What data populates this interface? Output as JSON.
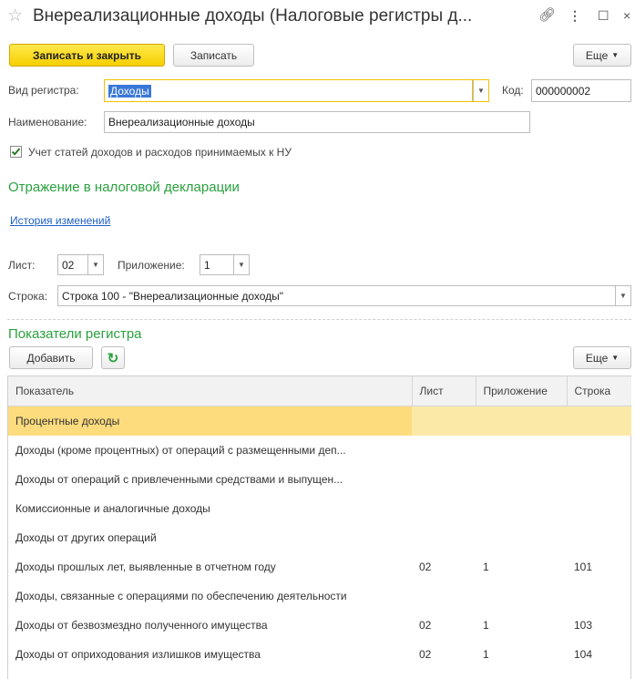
{
  "window": {
    "title": "Внереализационные доходы (Налоговые регистры д...",
    "controls": [
      "link-icon",
      "more-icon",
      "maximize-icon",
      "close-icon"
    ]
  },
  "toolbar": {
    "save_close": "Записать и закрыть",
    "save": "Записать",
    "more": "Еще"
  },
  "form": {
    "type_label": "Вид регистра:",
    "type_value": "Доходы",
    "code_label": "Код:",
    "code_value": "000000002",
    "name_label": "Наименование:",
    "name_value": "Внереализационные доходы",
    "checkbox_label": "Учет статей доходов и расходов принимаемых к НУ",
    "checkbox_checked": true
  },
  "declaration": {
    "section_title": "Отражение в налоговой декларации",
    "history_link": "История изменений",
    "sheet_label": "Лист:",
    "sheet_value": "02",
    "appendix_label": "Приложение:",
    "appendix_value": "1",
    "line_label": "Строка:",
    "line_value": "Строка 100 - \"Внереализационные доходы\""
  },
  "indicators": {
    "section_title": "Показатели регистра",
    "add_button": "Добавить",
    "more": "Еще",
    "columns": [
      "Показатель",
      "Лист",
      "Приложение",
      "Строка"
    ],
    "rows": [
      [
        "Процентные доходы",
        "",
        "",
        ""
      ],
      [
        "Доходы (кроме процентных) от операций с размещенными деп...",
        "",
        "",
        ""
      ],
      [
        "Доходы от операций с привлеченными средствами и выпущен...",
        "",
        "",
        ""
      ],
      [
        "Комиссионные и аналогичные доходы",
        "",
        "",
        ""
      ],
      [
        "Доходы от других операций",
        "",
        "",
        ""
      ],
      [
        "Доходы прошлых лет, выявленные в отчетном году",
        "02",
        "1",
        "101"
      ],
      [
        "Доходы, связанные с операциями по обеспечению деятельности",
        "",
        "",
        ""
      ],
      [
        "Доходы от безвозмездно полученного имущества",
        "02",
        "1",
        "103"
      ],
      [
        "Доходы от оприходования излишков имущества",
        "02",
        "1",
        "104"
      ]
    ]
  },
  "colors": {
    "primary_button": "#f5cf00",
    "section_title": "#2aa13e",
    "link": "#1f5fc4",
    "selected_row": "#fbe9a8"
  }
}
